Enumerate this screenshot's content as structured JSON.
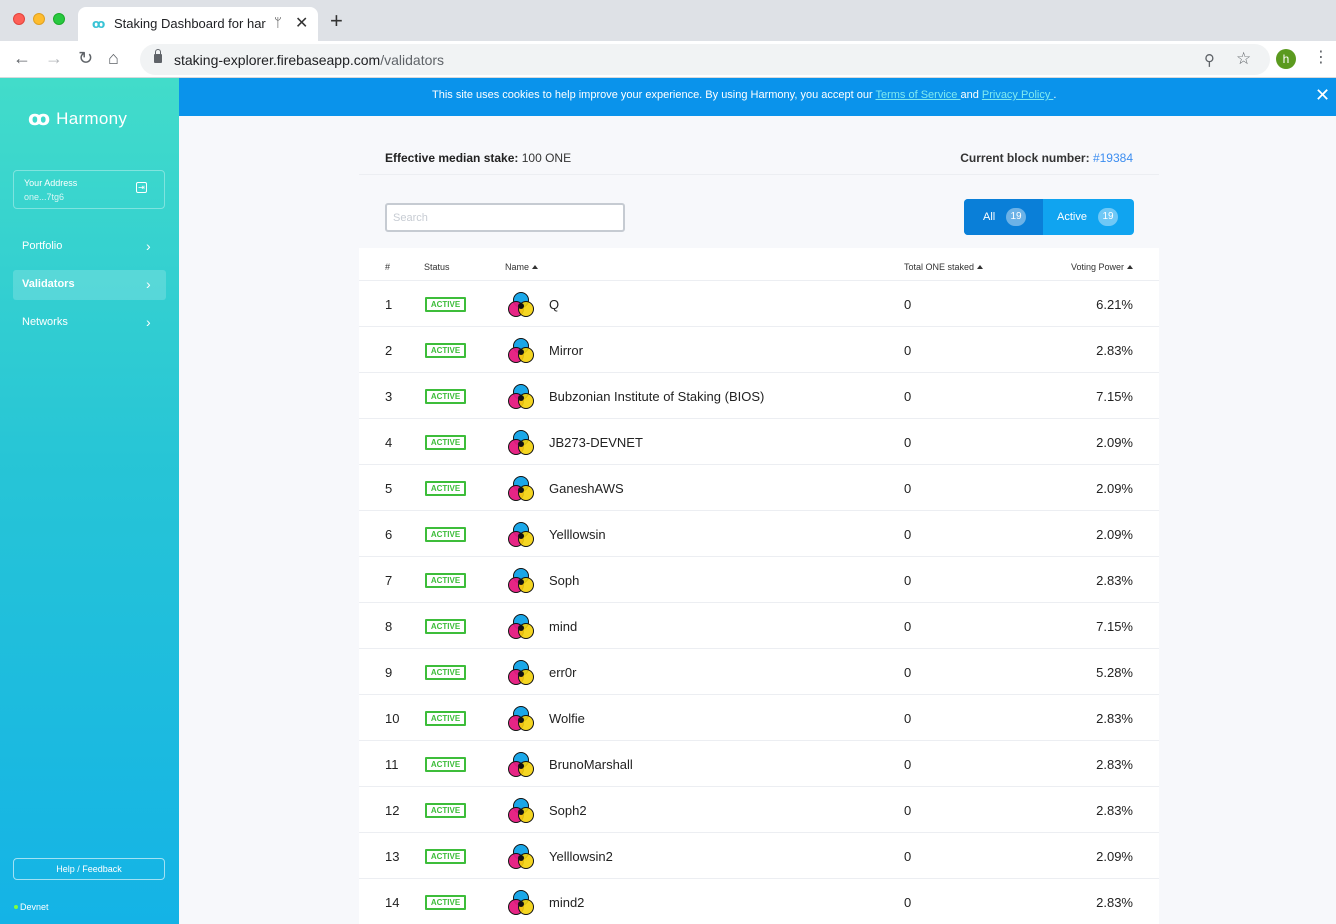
{
  "browser": {
    "tab_title": "Staking Dashboard for harm",
    "url_host": "staking-explorer.firebaseapp.com",
    "url_path": "/validators",
    "profile_initial": "h"
  },
  "sidebar": {
    "brand": "Harmony",
    "address_label": "Your Address",
    "address_value": "one...7tg6",
    "items": [
      {
        "label": "Portfolio"
      },
      {
        "label": "Validators"
      },
      {
        "label": "Networks"
      }
    ],
    "help_label": "Help / Feedback",
    "network_label": "Devnet"
  },
  "cookie": {
    "text_before": "This site uses cookies to help improve your experience. By using Harmony, you accept our ",
    "tos": "Terms of Service ",
    "and": "and ",
    "privacy": "Privacy Policy ",
    "period": "."
  },
  "summary": {
    "median_label": "Effective median stake:",
    "median_value": "100 ONE",
    "block_label": "Current block number:",
    "block_value": "#19384"
  },
  "search": {
    "placeholder": "Search"
  },
  "filters": {
    "all_label": "All",
    "all_count": "19",
    "active_label": "Active",
    "active_count": "19"
  },
  "table": {
    "headers": {
      "num": "#",
      "status": "Status",
      "name": "Name",
      "stake": "Total ONE staked",
      "power": "Voting Power"
    },
    "rows": [
      {
        "num": "1",
        "status": "ACTIVE",
        "name": "Q",
        "stake": "0",
        "power": "6.21%"
      },
      {
        "num": "2",
        "status": "ACTIVE",
        "name": "Mirror",
        "stake": "0",
        "power": "2.83%"
      },
      {
        "num": "3",
        "status": "ACTIVE",
        "name": "Bubzonian Institute of Staking (BIOS)",
        "stake": "0",
        "power": "7.15%"
      },
      {
        "num": "4",
        "status": "ACTIVE",
        "name": "JB273-DEVNET",
        "stake": "0",
        "power": "2.09%"
      },
      {
        "num": "5",
        "status": "ACTIVE",
        "name": "GaneshAWS",
        "stake": "0",
        "power": "2.09%"
      },
      {
        "num": "6",
        "status": "ACTIVE",
        "name": "Yelllowsin",
        "stake": "0",
        "power": "2.09%"
      },
      {
        "num": "7",
        "status": "ACTIVE",
        "name": "Soph",
        "stake": "0",
        "power": "2.83%"
      },
      {
        "num": "8",
        "status": "ACTIVE",
        "name": "mind",
        "stake": "0",
        "power": "7.15%"
      },
      {
        "num": "9",
        "status": "ACTIVE",
        "name": "err0r",
        "stake": "0",
        "power": "5.28%"
      },
      {
        "num": "10",
        "status": "ACTIVE",
        "name": "Wolfie",
        "stake": "0",
        "power": "2.83%"
      },
      {
        "num": "11",
        "status": "ACTIVE",
        "name": "BrunoMarshall",
        "stake": "0",
        "power": "2.83%"
      },
      {
        "num": "12",
        "status": "ACTIVE",
        "name": "Soph2",
        "stake": "0",
        "power": "2.83%"
      },
      {
        "num": "13",
        "status": "ACTIVE",
        "name": "Yelllowsin2",
        "stake": "0",
        "power": "2.09%"
      },
      {
        "num": "14",
        "status": "ACTIVE",
        "name": "mind2",
        "stake": "0",
        "power": "2.83%"
      }
    ]
  },
  "colors": {
    "accent": "#0a93eb",
    "active_badge": "#3dbd3a",
    "link": "#3c8df0"
  }
}
